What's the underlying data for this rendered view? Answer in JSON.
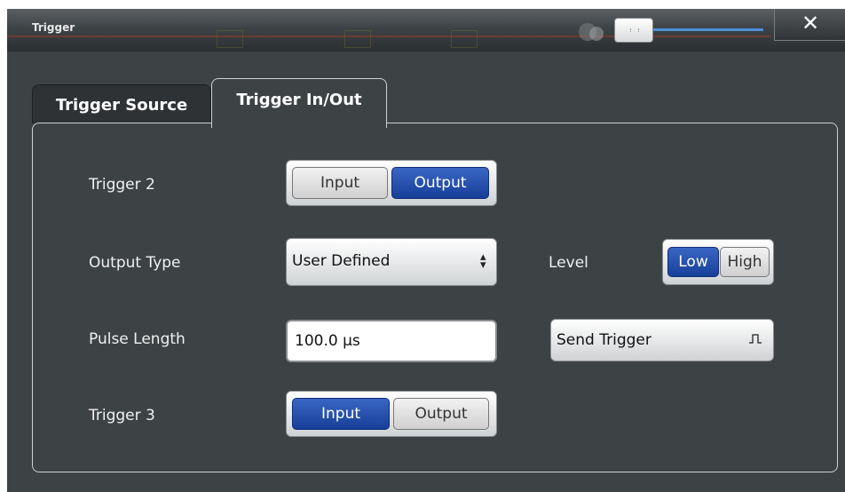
{
  "window": {
    "title": "Trigger",
    "close_glyph": "✕"
  },
  "tabs": [
    {
      "label": "Trigger Source",
      "active": false
    },
    {
      "label": "Trigger In/Out",
      "active": true
    }
  ],
  "trigger2": {
    "label": "Trigger 2",
    "options": [
      "Input",
      "Output"
    ],
    "selected": "Output"
  },
  "output_type": {
    "label": "Output Type",
    "value": "User Defined",
    "icon": "updown-icon"
  },
  "level": {
    "label": "Level",
    "options": [
      "Low",
      "High"
    ],
    "selected": "Low"
  },
  "pulse_length": {
    "label": "Pulse Length",
    "value": "100.0 µs"
  },
  "send_trigger": {
    "label": "Send Trigger",
    "icon": "pulse-icon"
  },
  "trigger3": {
    "label": "Trigger 3",
    "options": [
      "Input",
      "Output"
    ],
    "selected": "Input"
  },
  "colors": {
    "background": "#3d4245",
    "accent_selected": "#1f4aa8",
    "slider_track": "#4d8fd6",
    "text": "#f0f0f0"
  }
}
